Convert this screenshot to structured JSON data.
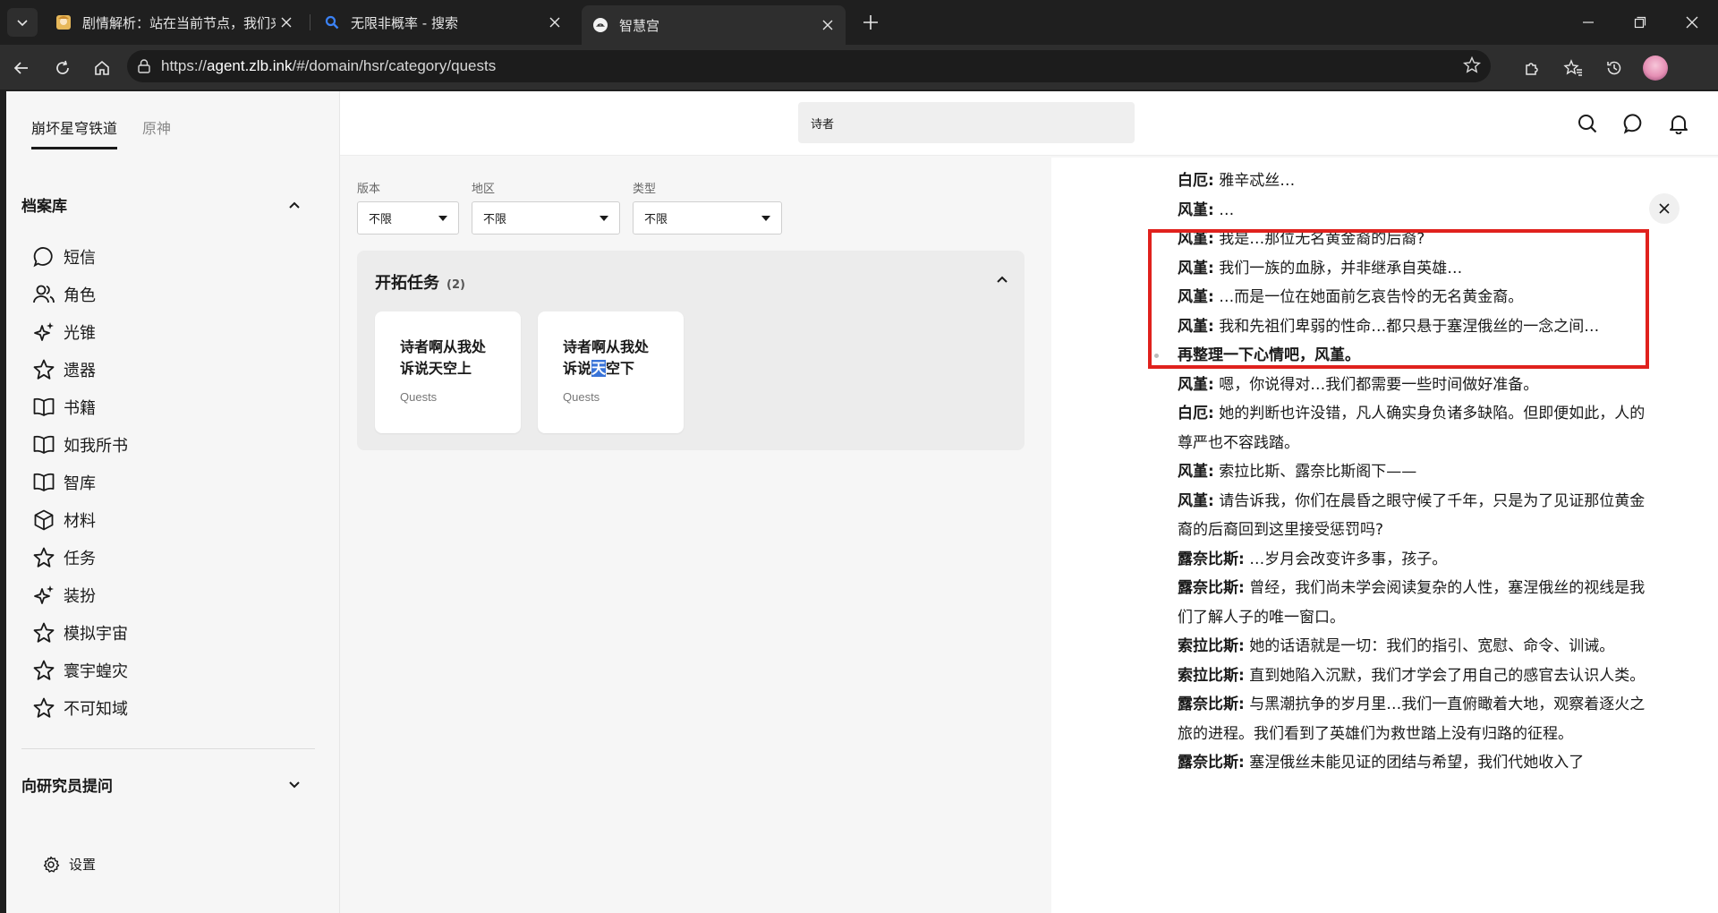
{
  "browser": {
    "tabs": [
      {
        "title": "剧情解析：站在当前节点，我们来",
        "active": false
      },
      {
        "title": "无限非概率 - 搜索",
        "active": false
      },
      {
        "title": "智慧宫",
        "active": true
      }
    ],
    "url_prefix": "https://",
    "url_host": "agent.zlb.ink",
    "url_path": "/#/domain/hsr/category/quests"
  },
  "sidebar": {
    "game_tabs": [
      "崩坏星穹铁道",
      "原神"
    ],
    "archive_title": "档案库",
    "items": [
      {
        "label": "短信",
        "icon": "message-icon"
      },
      {
        "label": "角色",
        "icon": "users-icon"
      },
      {
        "label": "光锥",
        "icon": "sparkles-icon"
      },
      {
        "label": "遗器",
        "icon": "star-icon"
      },
      {
        "label": "书籍",
        "icon": "book-icon"
      },
      {
        "label": "如我所书",
        "icon": "book-icon"
      },
      {
        "label": "智库",
        "icon": "book-icon"
      },
      {
        "label": "材料",
        "icon": "cube-icon"
      },
      {
        "label": "任务",
        "icon": "star-icon"
      },
      {
        "label": "装扮",
        "icon": "sparkles-icon"
      },
      {
        "label": "模拟宇宙",
        "icon": "star-icon"
      },
      {
        "label": "寰宇蝗灾",
        "icon": "star-icon"
      },
      {
        "label": "不可知域",
        "icon": "star-icon"
      }
    ],
    "ask_title": "向研究员提问",
    "settings_label": "设置"
  },
  "topbar": {
    "search_value": "诗者"
  },
  "filters": [
    {
      "label": "版本",
      "value": "不限"
    },
    {
      "label": "地区",
      "value": "不限"
    },
    {
      "label": "类型",
      "value": "不限"
    }
  ],
  "quests": {
    "title": "开拓任务",
    "count": "(2)",
    "cards": [
      {
        "title": "诗者啊从我处诉说天空上",
        "subtitle": "Quests"
      },
      {
        "title_pre": "诗者啊从我处诉说",
        "title_hl": "天",
        "title_post": "空下",
        "subtitle": "Quests"
      }
    ]
  },
  "detail": {
    "lines_before": [
      {
        "speaker": "白厄:",
        "text": "雅辛忒丝…"
      },
      {
        "speaker": "风堇:",
        "text": "…"
      },
      {
        "speaker": "风堇:",
        "text": "我是…那位无名黄金裔的后裔?"
      },
      {
        "speaker": "风堇:",
        "text": "我们一族的血脉，并非继承自英雄…"
      },
      {
        "speaker": "风堇:",
        "text": "…而是一位在她面前乞哀告怜的无名黄金裔。"
      },
      {
        "speaker": "风堇:",
        "text": "我和先祖们卑弱的性命…都只悬于塞涅俄丝的一念之间…"
      }
    ],
    "option": "再整理一下心情吧，风堇。",
    "lines_after": [
      {
        "speaker": "风堇:",
        "text": "嗯，你说得对…我们都需要一些时间做好准备。"
      },
      {
        "speaker": "白厄:",
        "text": "她的判断也许没错，凡人确实身负诸多缺陷。但即便如此，人的尊严也不容践踏。"
      },
      {
        "speaker": "风堇:",
        "text": "索拉比斯、露奈比斯阁下——"
      },
      {
        "speaker": "风堇:",
        "text": "请告诉我，你们在晨昏之眼守候了千年，只是为了见证那位黄金裔的后裔回到这里接受惩罚吗?"
      },
      {
        "speaker": "露奈比斯:",
        "text": "…岁月会改变许多事，孩子。"
      },
      {
        "speaker": "露奈比斯:",
        "text": "曾经，我们尚未学会阅读复杂的人性，塞涅俄丝的视线是我们了解人子的唯一窗口。"
      },
      {
        "speaker": "索拉比斯:",
        "text": "她的话语就是一切：我们的指引、宽慰、命令、训诫。"
      },
      {
        "speaker": "索拉比斯:",
        "text": "直到她陷入沉默，我们才学会了用自己的感官去认识人类。"
      },
      {
        "speaker": "露奈比斯:",
        "text": "与黑潮抗争的岁月里…我们一直俯瞰着大地，观察着逐火之旅的进程。我们看到了英雄们为救世踏上没有归路的征程。"
      },
      {
        "speaker": "露奈比斯:",
        "text": "塞涅俄丝未能见证的团结与希望，我们代她收入了"
      }
    ]
  },
  "colors": {
    "highlight_box": "#e0211d",
    "text_highlight": "#3a74d8"
  }
}
